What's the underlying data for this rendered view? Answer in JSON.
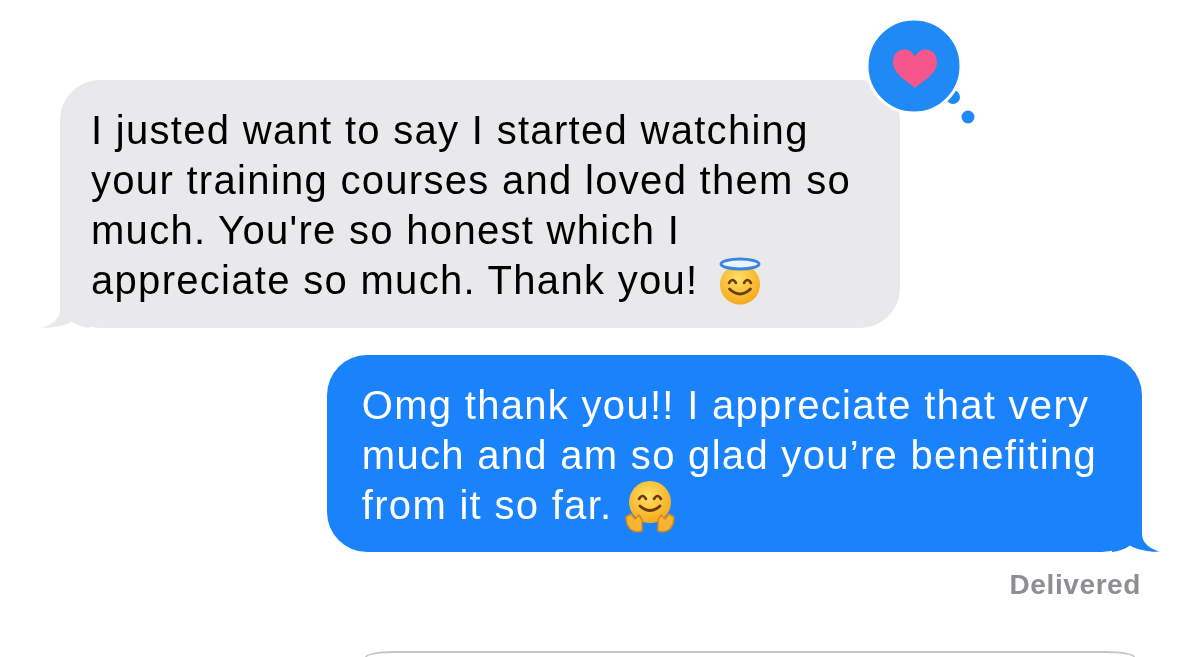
{
  "messages": [
    {
      "kind": "received",
      "loved": true,
      "parts": [
        {
          "kind": "text",
          "lines": [
            "I justed want to say I started watching",
            "your training courses and loved them so",
            "much. You're so honest which I",
            "appreciate so much. Thank you!"
          ]
        },
        {
          "kind": "halo"
        }
      ]
    },
    {
      "kind": "sent",
      "loved": false,
      "parts": [
        {
          "kind": "text",
          "lines": [
            "Omg thank you!! I appreciate that very",
            "much and am so glad you’re benefiting",
            "from it so far."
          ]
        },
        {
          "kind": "hugging"
        }
      ],
      "status": "Delivered"
    }
  ]
}
